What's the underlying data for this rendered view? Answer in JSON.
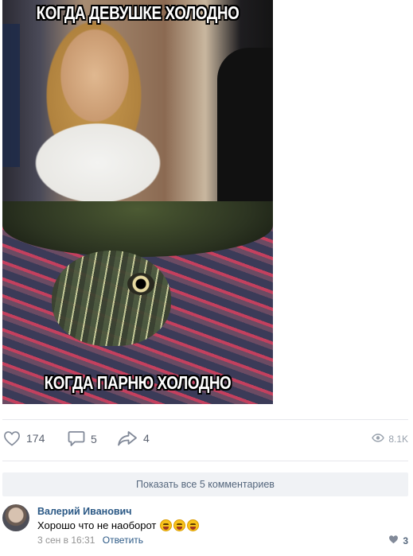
{
  "meme": {
    "top_caption": "КОГДА ДЕВУШКЕ ХОЛОДНО",
    "bottom_caption": "КОГДА ПАРНЮ ХОЛОДНО"
  },
  "actions": {
    "likes": "174",
    "comments": "5",
    "shares": "4",
    "views": "8.1K"
  },
  "show_all_comments": "Показать все 5 комментариев",
  "comment": {
    "author": "Валерий Иванович",
    "text": "Хорошо что не наоборот",
    "emoji_count": 3,
    "date": "3 сен в 16:31",
    "reply_label": "Ответить",
    "likes": "3"
  },
  "colors": {
    "link": "#2a5885",
    "icon": "#828a99",
    "divider": "#e7e8ec",
    "button_bg": "#f0f2f5"
  },
  "icons": [
    "heart-icon",
    "comment-icon",
    "share-icon",
    "eye-icon"
  ]
}
